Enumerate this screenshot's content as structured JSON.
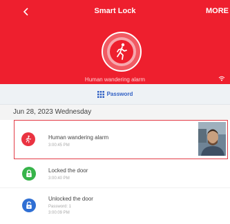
{
  "header": {
    "title": "Smart Lock",
    "more_label": "MORE",
    "back_icon": "chevron-left-icon",
    "alarm_caption": "Human wandering alarm",
    "status_icon": "wifi-icon"
  },
  "tabs": {
    "password_label": "Password",
    "password_icon": "grid-icon"
  },
  "date_header": "Jun 28, 2023 Wednesday",
  "events": [
    {
      "title": "Human wandering alarm",
      "time": "3:00:45 PM",
      "icon": "walking-person-icon",
      "color": "#ea3341"
    },
    {
      "title": "Locked the door",
      "time": "3:00:40 PM",
      "icon": "padlock-closed-icon",
      "color": "#37b44a"
    },
    {
      "title": "Unlocked the door",
      "detail": "Password: 1",
      "time": "3:00:09 PM",
      "icon": "padlock-open-icon",
      "color": "#2f6fd4"
    }
  ],
  "colors": {
    "brand_red": "#ee1f2e",
    "link_blue": "#2f5fc4",
    "highlight_border": "#e33a46"
  }
}
